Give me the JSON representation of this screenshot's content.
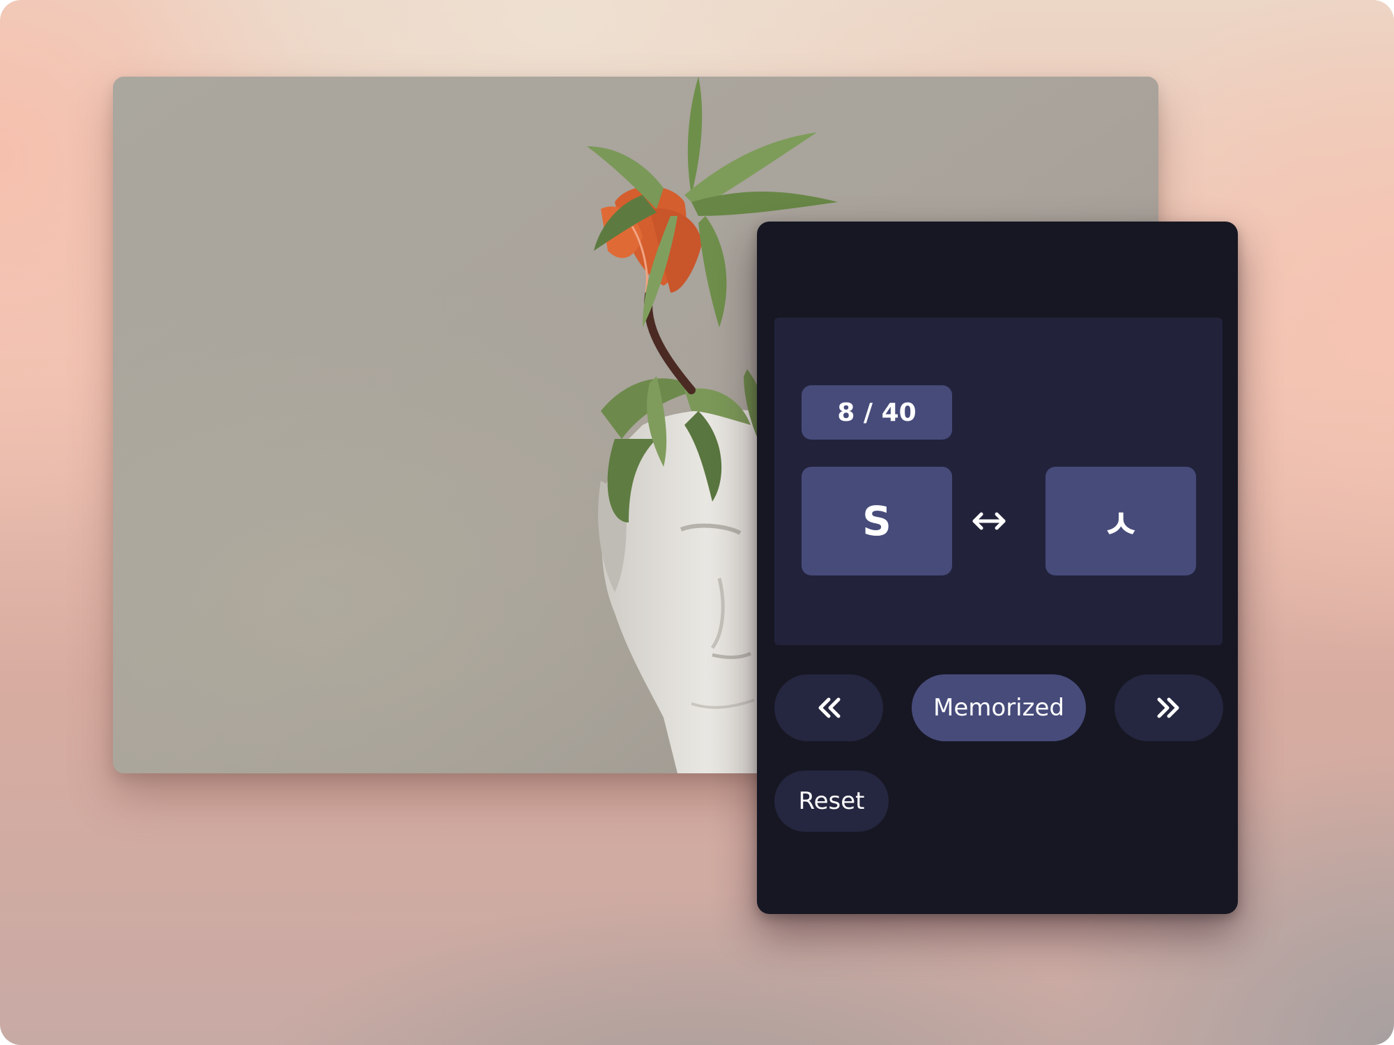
{
  "flashcard": {
    "counter": "8 / 40",
    "front_glyph": "S",
    "back_glyph": "ㅅ",
    "swap_icon": "left-right-arrow-icon"
  },
  "controls": {
    "prev_icon": "double-chevron-left-icon",
    "next_icon": "double-chevron-right-icon",
    "memorized_label": "Memorized",
    "reset_label": "Reset"
  },
  "colors": {
    "panel_background": "#171723",
    "card_area_background": "#22233b",
    "tile_background": "#464b7a",
    "secondary_button_background": "#25263f",
    "text": "#ffffff"
  },
  "photo": {
    "subject": "white classical statue head with orange crown imperial flower"
  }
}
